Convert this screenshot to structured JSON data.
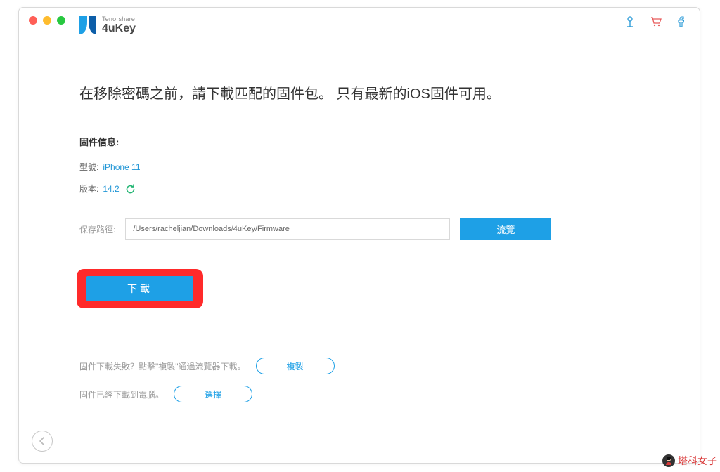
{
  "brand": {
    "company": "Tenorshare",
    "product": "4uKey"
  },
  "headline": "在移除密碼之前，請下載匹配的固件包。 只有最新的iOS固件可用。",
  "firmware": {
    "section_label": "固件信息:",
    "model_label": "型號:",
    "model_value": "iPhone 11",
    "version_label": "版本:",
    "version_value": "14.2"
  },
  "path": {
    "label": "保存路徑:",
    "value": "/Users/racheljian/Downloads/4uKey/Firmware"
  },
  "buttons": {
    "browse": "流覽",
    "download": "下載",
    "copy": "複製",
    "select": "選擇"
  },
  "footer": {
    "fail_text": "固件下載失敗？點擊\"複製\"通過流覽器下載。",
    "already_text": "固件已經下載到電腦。"
  },
  "watermark": "塔科女子"
}
